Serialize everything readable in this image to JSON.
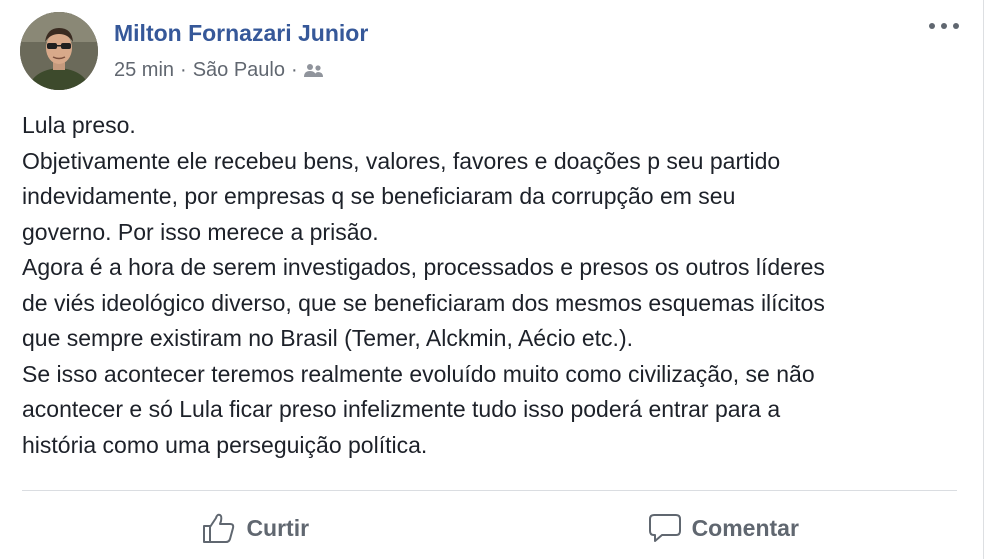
{
  "post": {
    "author": "Milton Fornazari Junior",
    "time": "25 min",
    "separator": "·",
    "location": "São Paulo",
    "separator2": "·",
    "audience_icon": "friends-icon",
    "more_icon": "more-options-icon",
    "lines": [
      "Lula preso.",
      "Objetivamente ele recebeu bens, valores, favores e doações p seu partido",
      "indevidamente, por empresas q se beneficiaram da corrupção em seu",
      "governo. Por isso merece a prisão.",
      "Agora é a hora de serem investigados, processados e presos os outros líderes",
      "de viés ideológico diverso, que se beneficiaram dos mesmos esquemas ilícitos",
      "que sempre existiram no Brasil (Temer, Alckmin, Aécio etc.).",
      "Se isso acontecer teremos realmente evoluído muito como civilização, se não",
      "acontecer e só Lula ficar preso infelizmente tudo isso poderá entrar para a",
      "história como uma perseguição política."
    ]
  },
  "actions": {
    "like_label": "Curtir",
    "like_icon": "thumbs-up-icon",
    "comment_label": "Comentar",
    "comment_icon": "comment-bubble-icon"
  },
  "colors": {
    "author_link": "#365899",
    "meta_text": "#616770",
    "body_text": "#1d2129",
    "action_text": "#606770"
  }
}
